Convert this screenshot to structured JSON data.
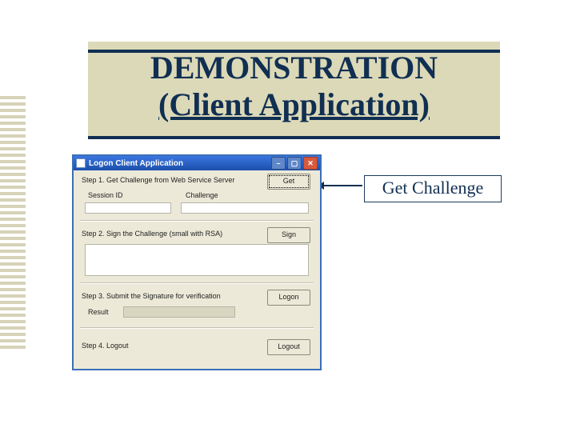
{
  "title_line1": "DEMONSTRATION",
  "title_line2": "(Client Application)",
  "callout": "Get Challenge",
  "window": {
    "title": "Logon Client Application",
    "step1": "Step 1. Get Challenge from Web Service Server",
    "session_label": "Session ID",
    "challenge_label": "Challenge",
    "get_btn": "Get",
    "step2": "Step 2. Sign the Challenge (small with RSA)",
    "sign_btn": "Sign",
    "step3": "Step 3. Submit the Signature for verification",
    "logon_btn": "Logon",
    "result_label": "Result",
    "step4": "Step 4. Logout",
    "logout_btn": "Logout"
  }
}
